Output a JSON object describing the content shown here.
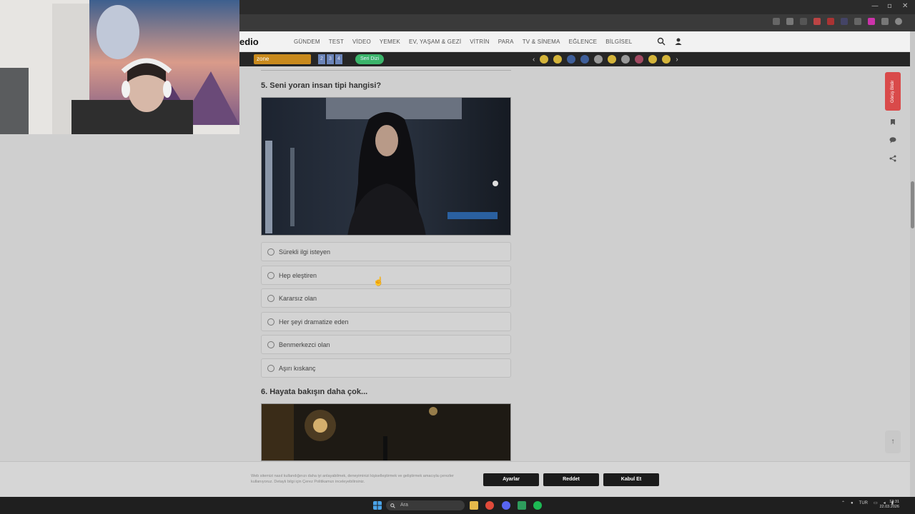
{
  "site": {
    "logo": "edio",
    "nav": [
      "GÜNDEM",
      "TEST",
      "VİDEO",
      "YEMEK",
      "EV, YAŞAM & GEZİ",
      "VİTRİN",
      "PARA",
      "TV & SİNEMA",
      "EĞLENCE",
      "BİLGİSEL"
    ]
  },
  "banner": {
    "zone_label": "zone",
    "numbers": [
      "2",
      "3",
      "4"
    ],
    "seri_label": "Seri Dizi"
  },
  "questions": [
    {
      "title": "5. Seni yoran insan tipi hangisi?",
      "options": [
        "Sürekli ilgi isteyen",
        "Hep eleştiren",
        "Kararsız olan",
        "Her şeyi dramatize eden",
        "Benmerkezci olan",
        "Aşırı kıskanç"
      ]
    },
    {
      "title": "6. Hayata bakışın daha çok..."
    }
  ],
  "feedback_label": "Görüş Bildir",
  "cookie": {
    "text": "Web sitemizi nasıl kullandığınızı daha iyi anlayabilmek, deneyiminizi kişiselleştirmek ve geliştirmek amacıyla çerezler kullanıyoruz. Detaylı bilgi için Çerez Politikamızı inceleyebilirsiniz.",
    "settings": "Ayarlar",
    "reject": "Reddet",
    "accept": "Kabul Et"
  },
  "taskbar": {
    "search_placeholder": "Ara",
    "language": "TUR",
    "time": "13:31",
    "date": "22.03.2026"
  },
  "colors": {
    "feedback": "#d94a4a",
    "button_dark": "#1b1b1b",
    "zone": "#c98a1d"
  }
}
